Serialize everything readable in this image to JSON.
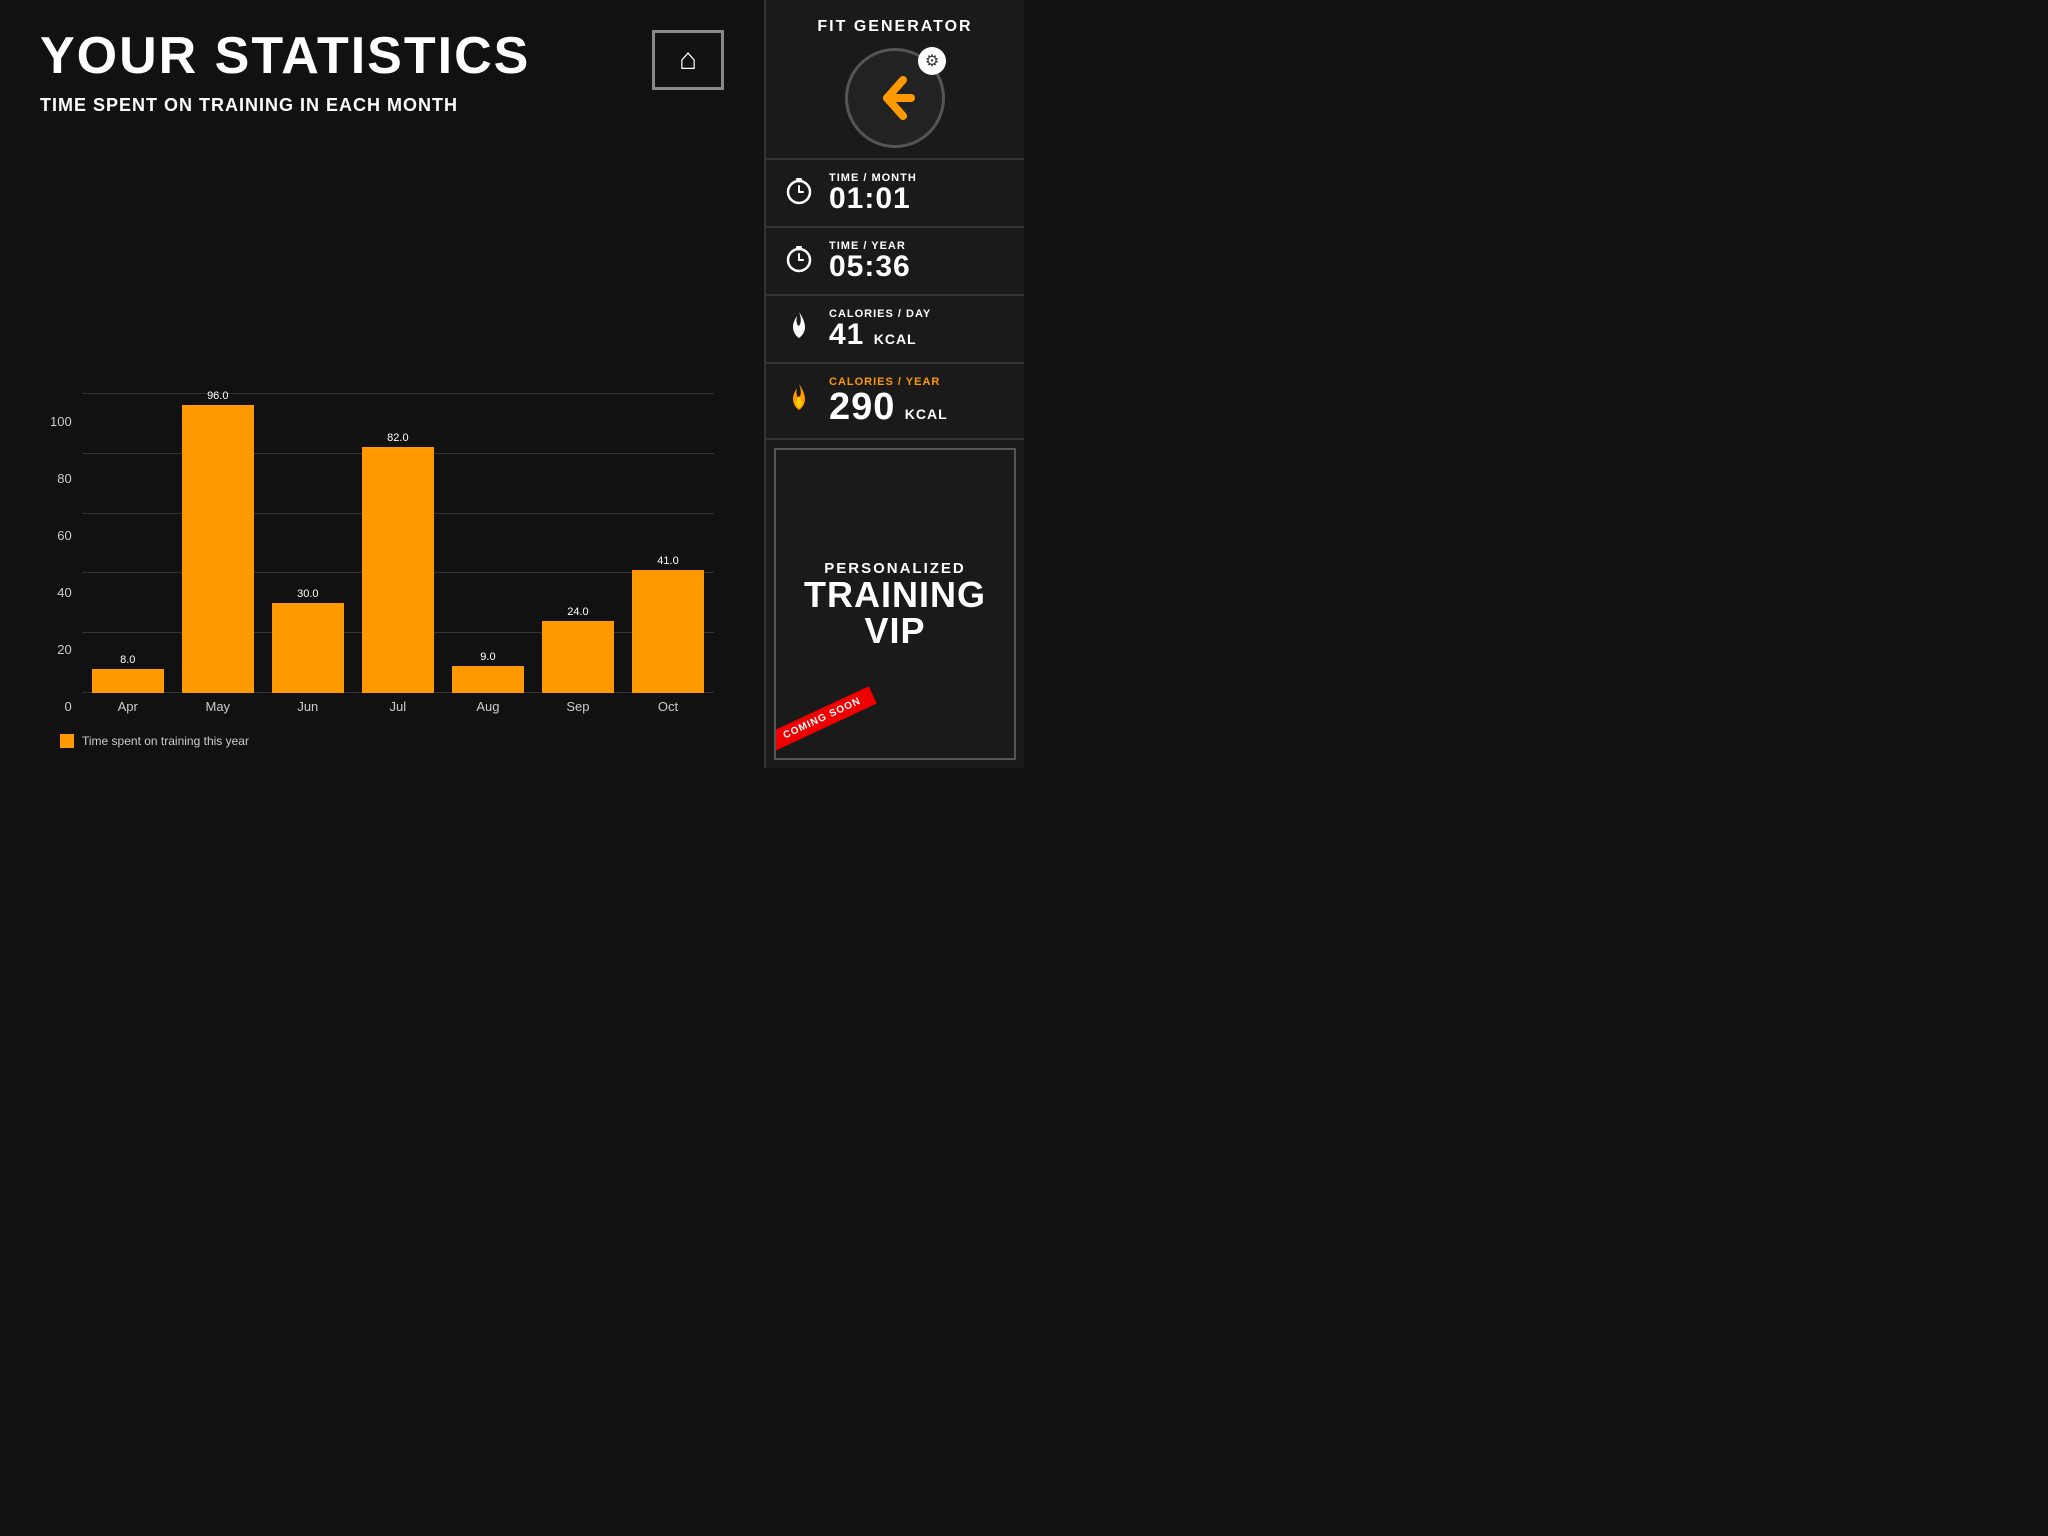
{
  "page": {
    "title": "YOUR STATISTICS",
    "subtitle": "TIME SPENT ON TRAINING IN EACH MONTH"
  },
  "home_button": {
    "label": "Home"
  },
  "chart": {
    "y_labels": [
      "100",
      "80",
      "60",
      "40",
      "20",
      "0"
    ],
    "bars": [
      {
        "month": "Apr",
        "value": 8.0,
        "height_pct": 8
      },
      {
        "month": "May",
        "value": 96.0,
        "height_pct": 96
      },
      {
        "month": "Jun",
        "value": 30.0,
        "height_pct": 30
      },
      {
        "month": "Jul",
        "value": 82.0,
        "height_pct": 82
      },
      {
        "month": "Aug",
        "value": 9.0,
        "height_pct": 9
      },
      {
        "month": "Sep",
        "value": 24.0,
        "height_pct": 24
      },
      {
        "month": "Oct",
        "value": 41.0,
        "height_pct": 41
      }
    ],
    "legend_text": "Time spent on training this year"
  },
  "sidebar": {
    "app_title": "FIT GENERATOR",
    "stats": [
      {
        "label": "TIME / MONTH",
        "value": "01:01",
        "unit": "",
        "id": "time-month"
      },
      {
        "label": "TIME / YEAR",
        "value": "05:36",
        "unit": "",
        "id": "time-year"
      },
      {
        "label": "CALORIES / DAY",
        "value": "41",
        "unit": "KCAL",
        "id": "cal-day"
      },
      {
        "label": "CALORIES / YEAR",
        "value": "290",
        "unit": "KCAL",
        "id": "cal-year"
      }
    ],
    "vip": {
      "line1": "PERSONALIZED",
      "line2": "TRAINING",
      "line3": "VIP",
      "badge": "COMING SOON"
    }
  }
}
